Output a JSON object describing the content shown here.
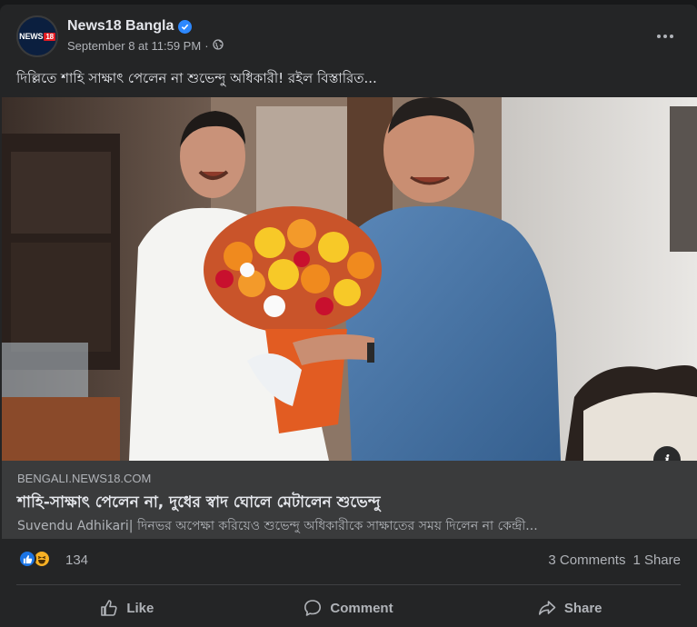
{
  "post": {
    "page_name": "News18 Bangla",
    "logo_text": "NEWS",
    "logo_number": "18",
    "timestamp": "September 8 at 11:59 PM",
    "separator": "·",
    "text": "দিল্লিতে শাহি সাক্ষাৎ পেলেন না শুভেন্দু অধিকারী! রইল বিস্তারিত..."
  },
  "link_preview": {
    "domain": "BENGALI.NEWS18.COM",
    "title": "শাহি-সাক্ষাৎ পেলেন না, দুধের স্বাদ ঘোলে মেটালেন শুভেন্দু",
    "description": "Suvendu Adhikari| দিনভর অপেক্ষা করিয়েও শুভেন্দু অধিকারীকে সাক্ষাতের সময় দিলেন না কেন্দ্রী..."
  },
  "engagement": {
    "reaction_count": "134",
    "comments": "3 Comments",
    "shares": "1 Share",
    "reactions": [
      "like-icon",
      "haha-icon"
    ]
  },
  "actions": {
    "like": "Like",
    "comment": "Comment",
    "share": "Share"
  },
  "colors": {
    "background": "#18191a",
    "card": "#242526",
    "link_box": "#3a3b3c",
    "primary_text": "#e4e6eb",
    "secondary_text": "#b0b3b8",
    "verified_blue": "#2d88ff",
    "like_blue": "#1b74e4",
    "haha_yellow": "#f7b125"
  }
}
